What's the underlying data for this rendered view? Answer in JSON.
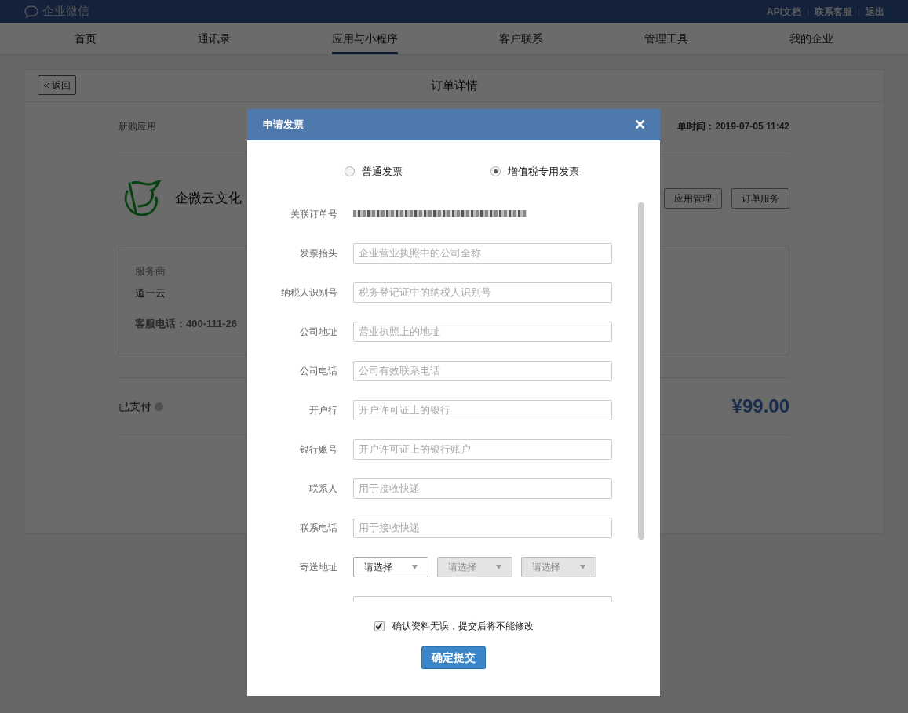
{
  "topbar": {
    "brand": "企业微信",
    "links": [
      "API文档",
      "联系客服",
      "退出"
    ]
  },
  "nav": [
    {
      "label": "首页",
      "selected": false
    },
    {
      "label": "通讯录",
      "selected": false
    },
    {
      "label": "应用与小程序",
      "selected": true
    },
    {
      "label": "客户联系",
      "selected": false
    },
    {
      "label": "管理工具",
      "selected": false
    },
    {
      "label": "我的企业",
      "selected": false
    }
  ],
  "page": {
    "back": "返回",
    "title": "订单详情",
    "order_type": "新购应用",
    "order_time": "单时间：2019-07-05 11:42",
    "app_name": "企微云文化",
    "actions": [
      "应用管理",
      "订单服务"
    ],
    "provider_label": "服务商",
    "provider": "道一云",
    "phone": "客服电话：400-111-26",
    "paid": "已支付",
    "price": "¥99.00"
  },
  "dialog": {
    "title": "申请发票",
    "close": "✕",
    "invoice_types": [
      {
        "label": "普通发票",
        "selected": false
      },
      {
        "label": "增值税专用发票",
        "selected": true
      }
    ],
    "order_label": "关联订单号",
    "fields": [
      {
        "label": "发票抬头",
        "placeholder": "企业营业执照中的公司全称"
      },
      {
        "label": "纳税人识别号",
        "placeholder": "税务登记证中的纳税人识别号"
      },
      {
        "label": "公司地址",
        "placeholder": "营业执照上的地址"
      },
      {
        "label": "公司电话",
        "placeholder": "公司有效联系电话"
      },
      {
        "label": "开户行",
        "placeholder": "开户许可证上的银行"
      },
      {
        "label": "银行账号",
        "placeholder": "开户许可证上的银行账户"
      },
      {
        "label": "联系人",
        "placeholder": "用于接收快递"
      },
      {
        "label": "联系电话",
        "placeholder": "用于接收快递"
      }
    ],
    "address_label": "寄送地址",
    "selects": [
      {
        "value": "请选择",
        "disabled": false
      },
      {
        "value": "请选择",
        "disabled": true
      },
      {
        "value": "请选择",
        "disabled": true
      }
    ],
    "confirm": {
      "label": "确认资料无误，提交后将不能修改",
      "checked": true
    },
    "submit": "确定提交"
  }
}
